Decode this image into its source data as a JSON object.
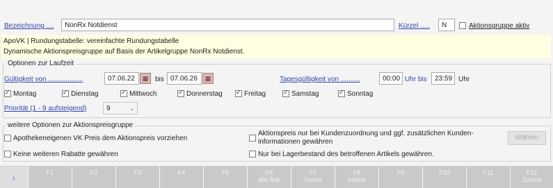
{
  "header": {
    "bezeichnung_label": "Bezeichnung ....",
    "bezeichnung_value": "NonRx Notdienst",
    "kuerzel_label": "Kürzel .....",
    "kuerzel_value": "N",
    "aktionsgruppe_aktiv_label": "Aktionsgruppe aktiv",
    "aktionsgruppe_aktiv_checked": false
  },
  "info": {
    "line1": "ApoVK | Rundungstabelle: vereinfachte Rundungstabelle",
    "line2": "Dynamische Aktionspreisgruppe auf Basis der Artikelgruppe NonRx Notdienst."
  },
  "laufzeit": {
    "legend": "Optionen zur Laufzeit",
    "gueltigkeit_label": "Gültigkeit von ..................",
    "date_from": "07.06.22",
    "bis_label": "bis",
    "date_to": "07.06.26",
    "tages_label": "Tagesgültigkeit von ..........",
    "time_from": "00:00",
    "uhr_bis_label": "Uhr bis",
    "time_to": "23:59",
    "uhr_label": "Uhr",
    "days": [
      {
        "label": "Montag",
        "checked": true
      },
      {
        "label": "Dienstag",
        "checked": true
      },
      {
        "label": "Mittwoch",
        "checked": true
      },
      {
        "label": "Donnerstag",
        "checked": true
      },
      {
        "label": "Freitag",
        "checked": true
      },
      {
        "label": "Samstag",
        "checked": true
      },
      {
        "label": "Sonntag",
        "checked": true
      }
    ],
    "prioritaet_label": "Priorität (1 - 9 aufsteigend)",
    "prioritaet_value": "9"
  },
  "weitere": {
    "legend": "weitere Optionen zur Aktionspreisgruppe",
    "opt1": "Apothekeneigenen VK Preis dem Aktionspreis vorziehen",
    "opt2": "Keine weiteren Rabatte gewähren",
    "opt3_line1": "Aktionspreis nur bei Kundenzuordnung und ggf. zusätzlichen Kunden-",
    "opt3_line2": "informationen gewähren",
    "opt4": "Nur bei Lagerbestand des betroffenen Artikels gewähren.",
    "waehlen_label": "Wählen"
  },
  "fkeys": [
    {
      "key": "↓",
      "sub": ""
    },
    {
      "key": "F1",
      "sub": ""
    },
    {
      "key": "F2",
      "sub": ""
    },
    {
      "key": "F3",
      "sub": ""
    },
    {
      "key": "F4",
      "sub": ""
    },
    {
      "key": "F5",
      "sub": ""
    },
    {
      "key": "F6",
      "sub": "alle Artk"
    },
    {
      "key": "F7",
      "sub": "Suche"
    },
    {
      "key": "F8",
      "sub": "Import"
    },
    {
      "key": "F9",
      "sub": ""
    },
    {
      "key": "F10",
      "sub": ""
    },
    {
      "key": "F11",
      "sub": ""
    },
    {
      "key": "F12",
      "sub": "Zurück"
    }
  ]
}
